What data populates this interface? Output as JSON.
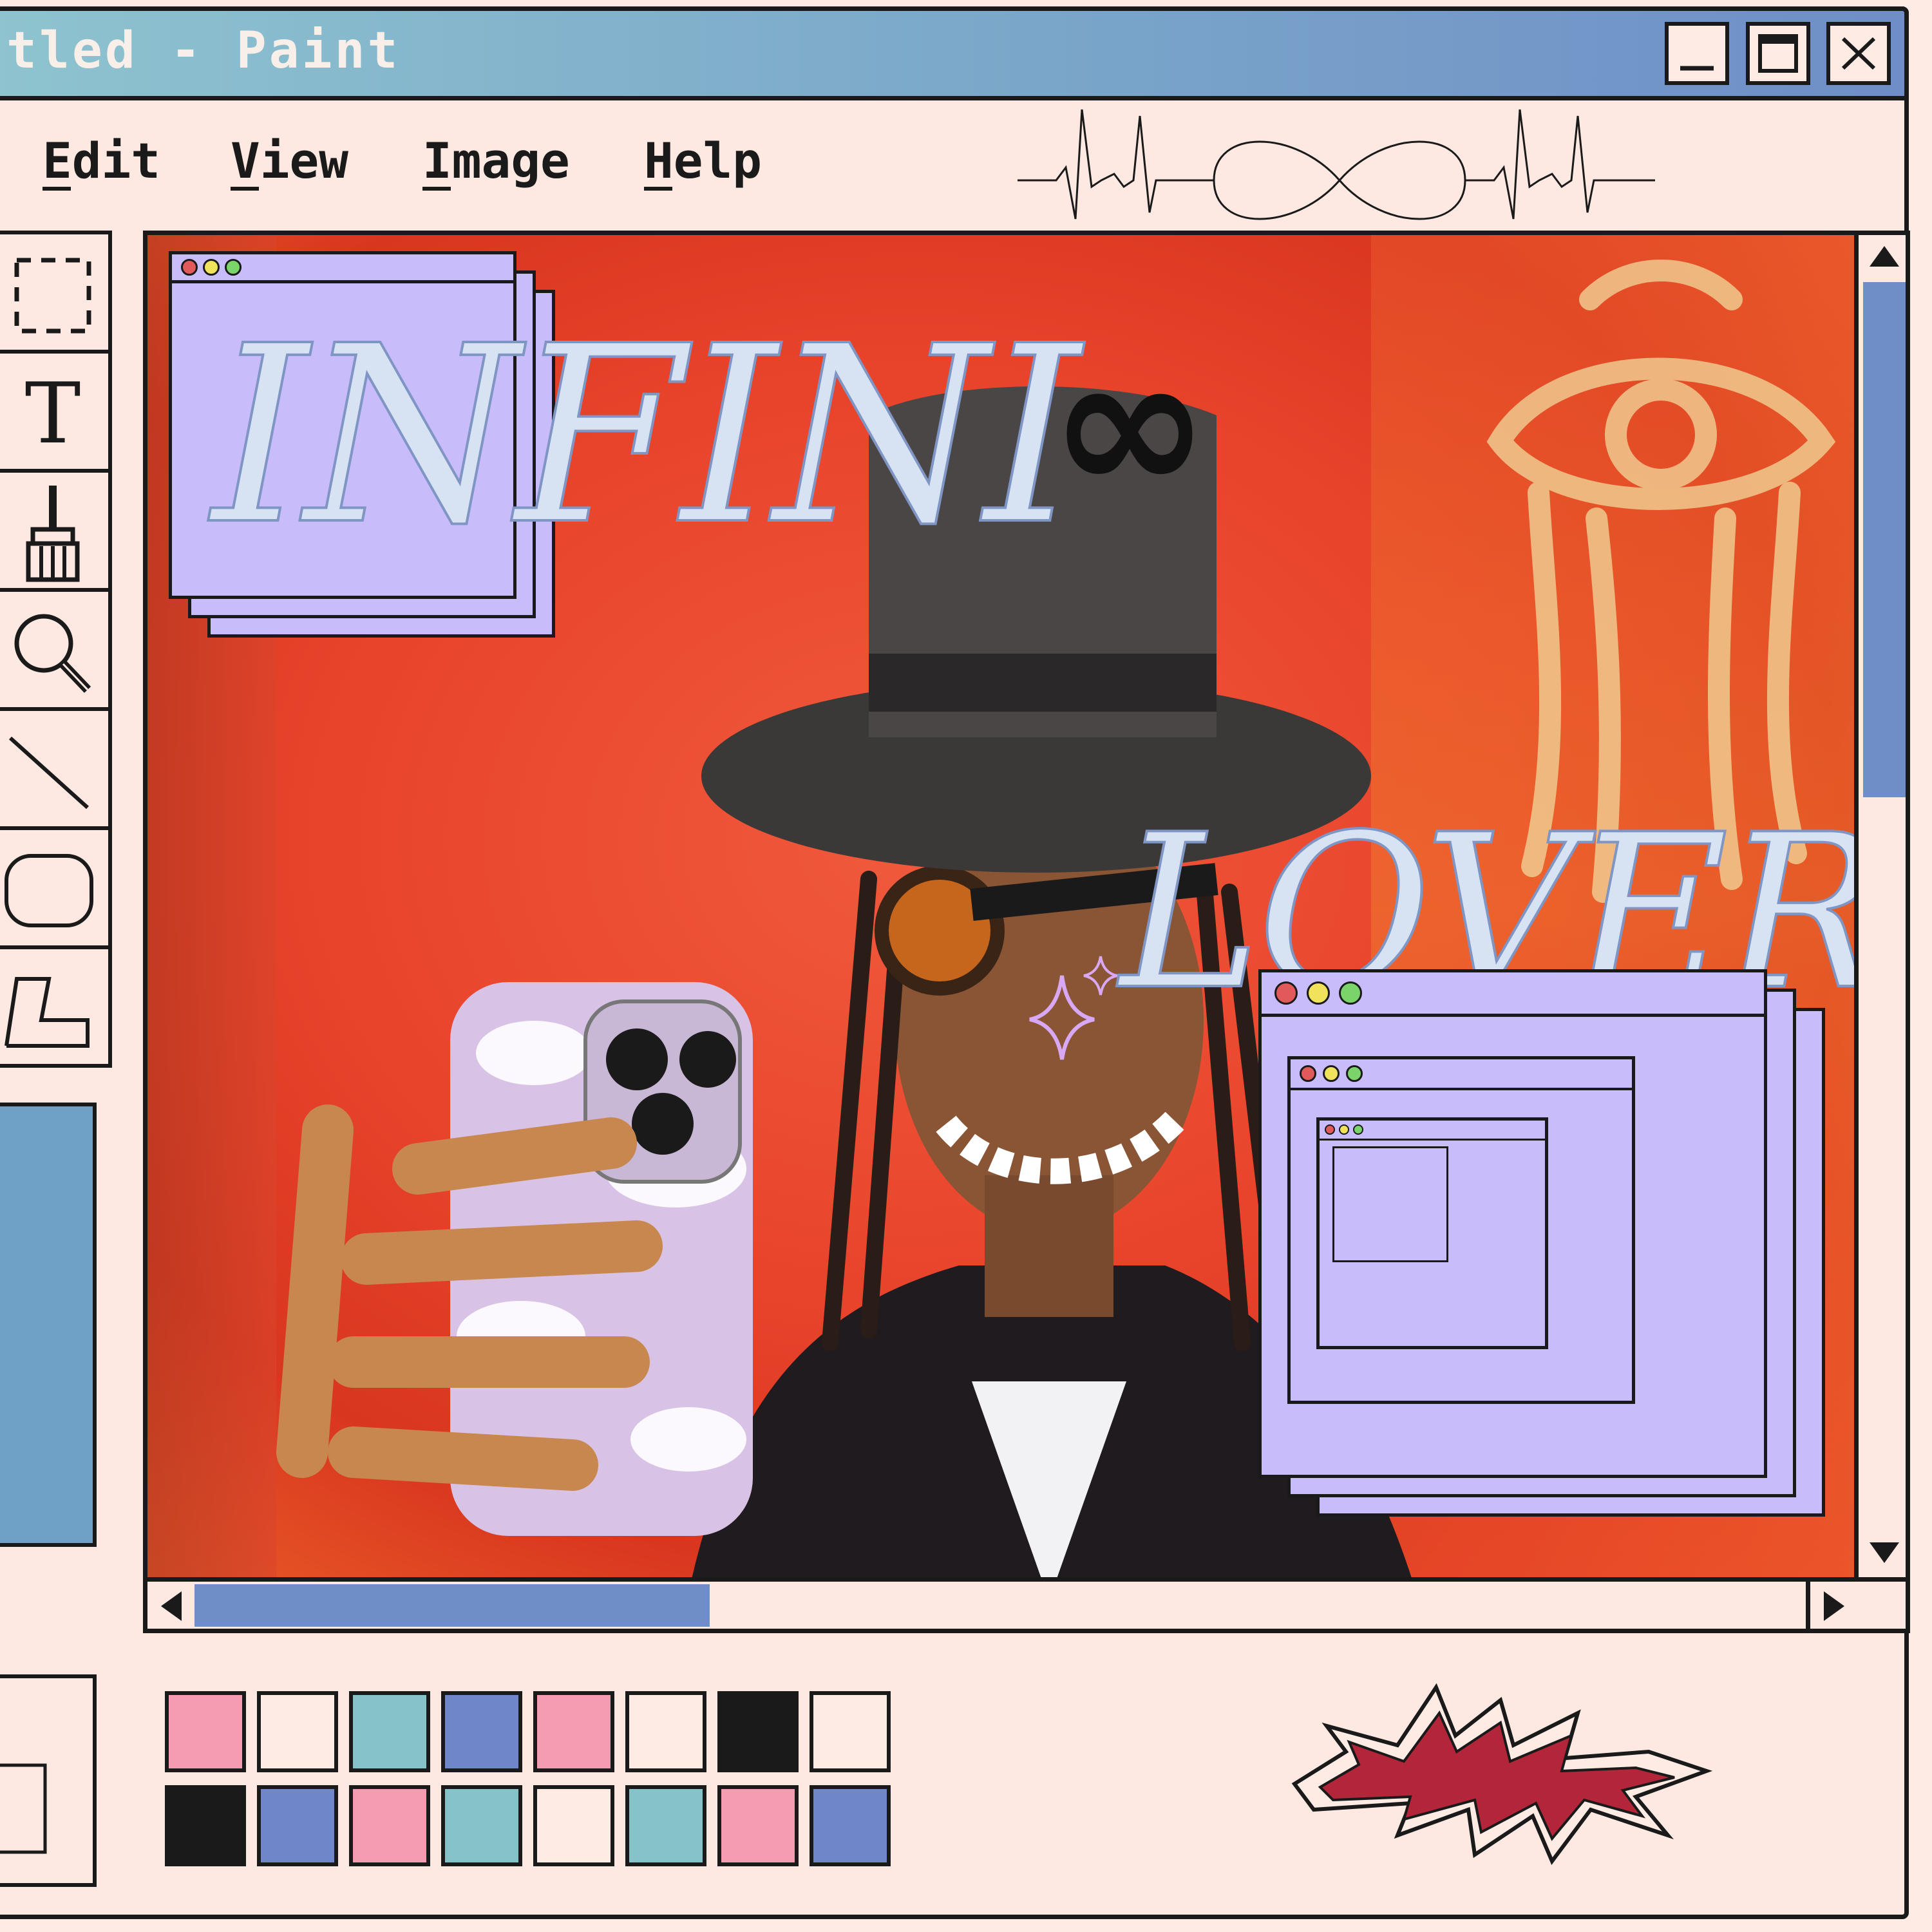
{
  "window": {
    "title": "tled - Paint",
    "controls": [
      "minimize",
      "maximize",
      "close"
    ]
  },
  "menu": {
    "items": [
      {
        "label": "Edit",
        "accel": "E"
      },
      {
        "label": "View",
        "accel": "V"
      },
      {
        "label": "Image",
        "accel": "I"
      },
      {
        "label": "Help",
        "accel": "H"
      }
    ]
  },
  "tools": [
    "select-rect-icon",
    "text-icon",
    "brush-icon",
    "magnifier-icon",
    "line-icon",
    "rounded-rect-icon",
    "polygon-icon"
  ],
  "tool_labels": {
    "text": "T"
  },
  "artwork": {
    "headline_1": "INFINI",
    "headline_2": "LOVER",
    "infinity_symbol": "∞"
  },
  "palette": {
    "row1": [
      "#f59bb2",
      "#fdebe4",
      "#86c3c9",
      "#6f86c8",
      "#f59bb2",
      "#fdebe4",
      "#1a1a1a",
      "#fdebe4"
    ],
    "row2": [
      "#1a1a1a",
      "#6f86c8",
      "#f59bb2",
      "#86c3c9",
      "#fdebe4",
      "#86c3c9",
      "#f59bb2",
      "#6f86c8"
    ]
  },
  "colors": {
    "title_gradient_start": "#8ec3cf",
    "title_gradient_end": "#6f8ec8",
    "scroll_thumb": "#6f8ec8",
    "window_bg": "#fde9e2",
    "popup_bg": "#c9bcfb",
    "canvas_red": "#e8432b"
  },
  "scroll": {
    "vertical_position": 0.0,
    "horizontal_position": 0.0
  }
}
